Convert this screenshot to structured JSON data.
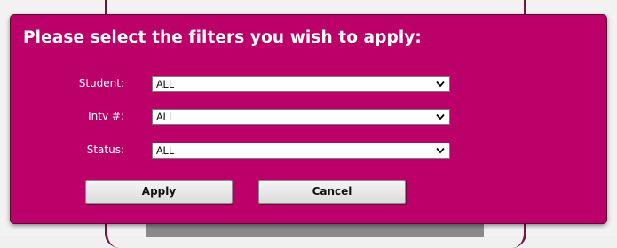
{
  "dialog": {
    "title": "Please select the filters you wish to apply:",
    "filters": [
      {
        "label": "Student:",
        "value": "ALL"
      },
      {
        "label": "Intv #:",
        "value": "ALL"
      },
      {
        "label": "Status:",
        "value": "ALL"
      }
    ],
    "apply_label": "Apply",
    "cancel_label": "Cancel"
  },
  "colors": {
    "dialog_background": "#bc0069",
    "title_text": "#ffffff",
    "button_background": "#e6e6e6"
  },
  "icons": {
    "select_arrow": "chevron-down-icon"
  }
}
